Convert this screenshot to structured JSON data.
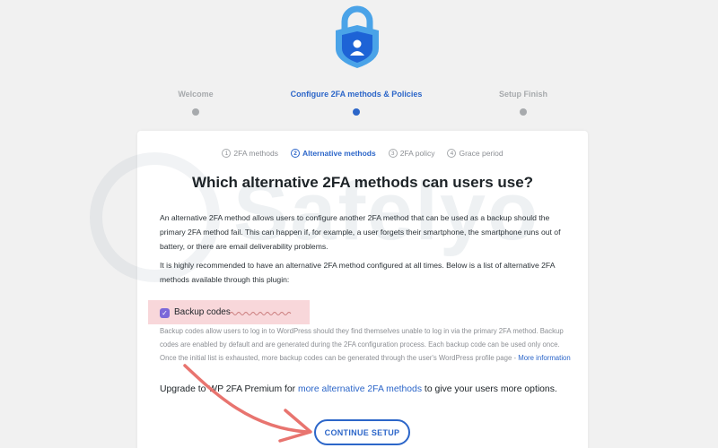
{
  "brand": {
    "logo_icon": "shield-lock-icon",
    "accent_color": "#2c66c9"
  },
  "wizard": {
    "steps": [
      {
        "label": "Welcome",
        "active": false
      },
      {
        "label": "Configure 2FA methods & Policies",
        "active": true
      },
      {
        "label": "Setup Finish",
        "active": false
      }
    ]
  },
  "substeps": [
    {
      "num": "1",
      "label": "2FA methods",
      "active": false
    },
    {
      "num": "2",
      "label": "Alternative methods",
      "active": true
    },
    {
      "num": "3",
      "label": "2FA policy",
      "active": false
    },
    {
      "num": "4",
      "label": "Grace period",
      "active": false
    }
  ],
  "watermark": {
    "text": "Safelyo"
  },
  "content": {
    "heading": "Which alternative 2FA methods can users use?",
    "paragraph1": "An alternative 2FA method allows users to configure another 2FA method that can be used as a backup should the primary 2FA method fail. This can happen if, for example, a user forgets their smartphone, the smartphone runs out of battery, or there are email deliverability problems.",
    "paragraph2": "It is highly recommended to have an alternative 2FA method configured at all times. Below is a list of alternative 2FA methods available through this plugin:"
  },
  "method": {
    "label": "Backup codes",
    "checked": true,
    "description": "Backup codes allow users to log in to WordPress should they find themselves unable to log in via the primary 2FA method. Backup codes are enabled by default and are generated during the 2FA configuration process. Each backup code can be used only once. Once the initial list is exhausted, more backup codes can be generated through the user's WordPress profile page - ",
    "more_link": "More information"
  },
  "upgrade": {
    "prefix": "Upgrade to WP 2FA Premium for ",
    "link": "more alternative 2FA methods",
    "suffix": " to give your users more options."
  },
  "buttons": {
    "continue": "CONTINUE SETUP"
  },
  "annotation": {
    "arrow_color": "#e8746f"
  }
}
